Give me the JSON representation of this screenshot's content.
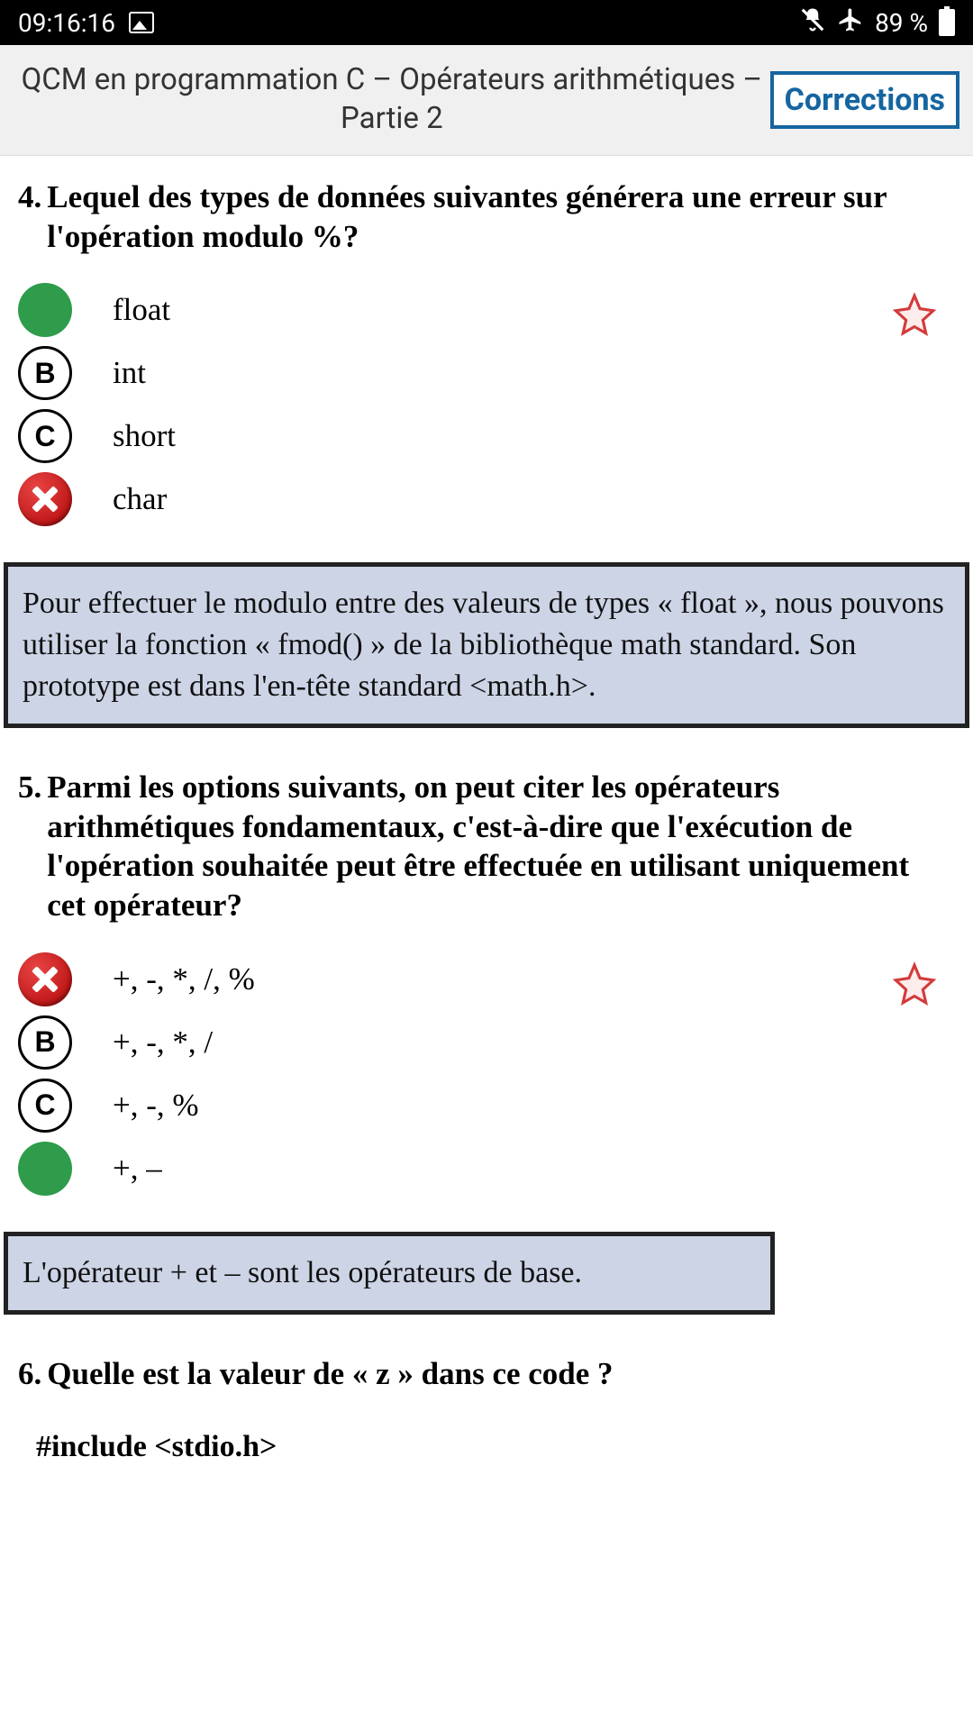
{
  "status": {
    "time": "09:16:16",
    "battery": "89 %"
  },
  "header": {
    "title": "QCM en programmation C – Opérateurs arithmétiques – Partie 2",
    "corrections_label": "Corrections"
  },
  "questions": [
    {
      "number": "4.",
      "text": "Lequel des types de données suivantes générera une erreur sur l'opération modulo %?",
      "answers": [
        {
          "state": "correct",
          "letter": "",
          "label": "float"
        },
        {
          "state": "letter",
          "letter": "B",
          "label": "int"
        },
        {
          "state": "letter",
          "letter": "C",
          "label": "short"
        },
        {
          "state": "wrong",
          "letter": "",
          "label": "char"
        }
      ],
      "explanation": "Pour effectuer le modulo entre des valeurs de types « float », nous pouvons utiliser la fonction « fmod() » de la bibliothèque math standard. Son prototype est dans l'en-tête standard <math.h>."
    },
    {
      "number": "5.",
      "text": "Parmi les options suivants, on peut citer les opérateurs arithmétiques fondamentaux, c'est-à-dire que l'exécution de l'opération souhaitée peut être effectuée en utilisant uniquement cet opérateur?",
      "answers": [
        {
          "state": "wrong",
          "letter": "",
          "label": "+, -, *, /, %"
        },
        {
          "state": "letter",
          "letter": "B",
          "label": "+, -, *, /"
        },
        {
          "state": "letter",
          "letter": "C",
          "label": "+, -, %"
        },
        {
          "state": "correct",
          "letter": "",
          "label": "+, –"
        }
      ],
      "explanation": "L'opérateur + et – sont les opérateurs de base."
    },
    {
      "number": "6.",
      "text": "Quelle est la valeur de « z » dans ce code ?",
      "code": "#include <stdio.h>"
    }
  ]
}
